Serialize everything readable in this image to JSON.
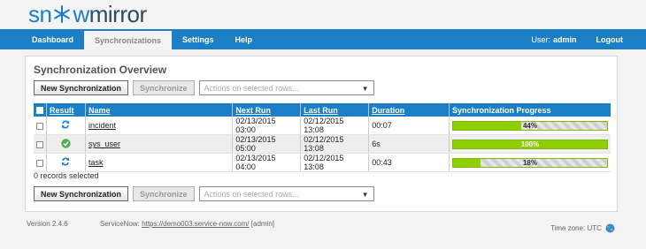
{
  "logo": {
    "part1": "sn",
    "part2": "w",
    "part3": "mirror"
  },
  "nav": {
    "items": [
      {
        "label": "Dashboard"
      },
      {
        "label": "Synchronizations"
      },
      {
        "label": "Settings"
      },
      {
        "label": "Help"
      }
    ],
    "user_prefix": "User:",
    "user_name": "admin",
    "logout": "Logout"
  },
  "panel": {
    "title": "Synchronization Overview",
    "new_sync_label": "New Synchronization",
    "synchronize_label": "Synchronize",
    "actions_placeholder": "Actions on selected rows...",
    "records_selected": "0 records selected"
  },
  "table": {
    "headers": [
      "Result",
      "Name",
      "Next Run",
      "Last Run",
      "Duration",
      "Synchronization Progress"
    ],
    "rows": [
      {
        "result": "sync",
        "name": "incident",
        "next_run": "02/13/2015 03:00",
        "last_run": "02/12/2015 13:08",
        "duration": "00:07",
        "progress": 44,
        "progress_label": "44%"
      },
      {
        "result": "success",
        "name": "sys_user",
        "next_run": "02/13/2015 05:00",
        "last_run": "02/12/2015 13:08",
        "duration": "6s",
        "progress": 100,
        "progress_label": "100%"
      },
      {
        "result": "sync",
        "name": "task",
        "next_run": "02/13/2015 04:00",
        "last_run": "02/12/2015 13:08",
        "duration": "00:43",
        "progress": 18,
        "progress_label": "18%"
      }
    ]
  },
  "footer": {
    "version": "Version 2.4.6",
    "service_prefix": "ServiceNow:",
    "service_url": "https://demo003.service-now.com/",
    "service_suffix": "[admin]",
    "timezone": "Time zone: UTC"
  },
  "colors": {
    "brand": "#1c7fc6",
    "progress": "#8fcf00",
    "success": "#4caf50"
  }
}
